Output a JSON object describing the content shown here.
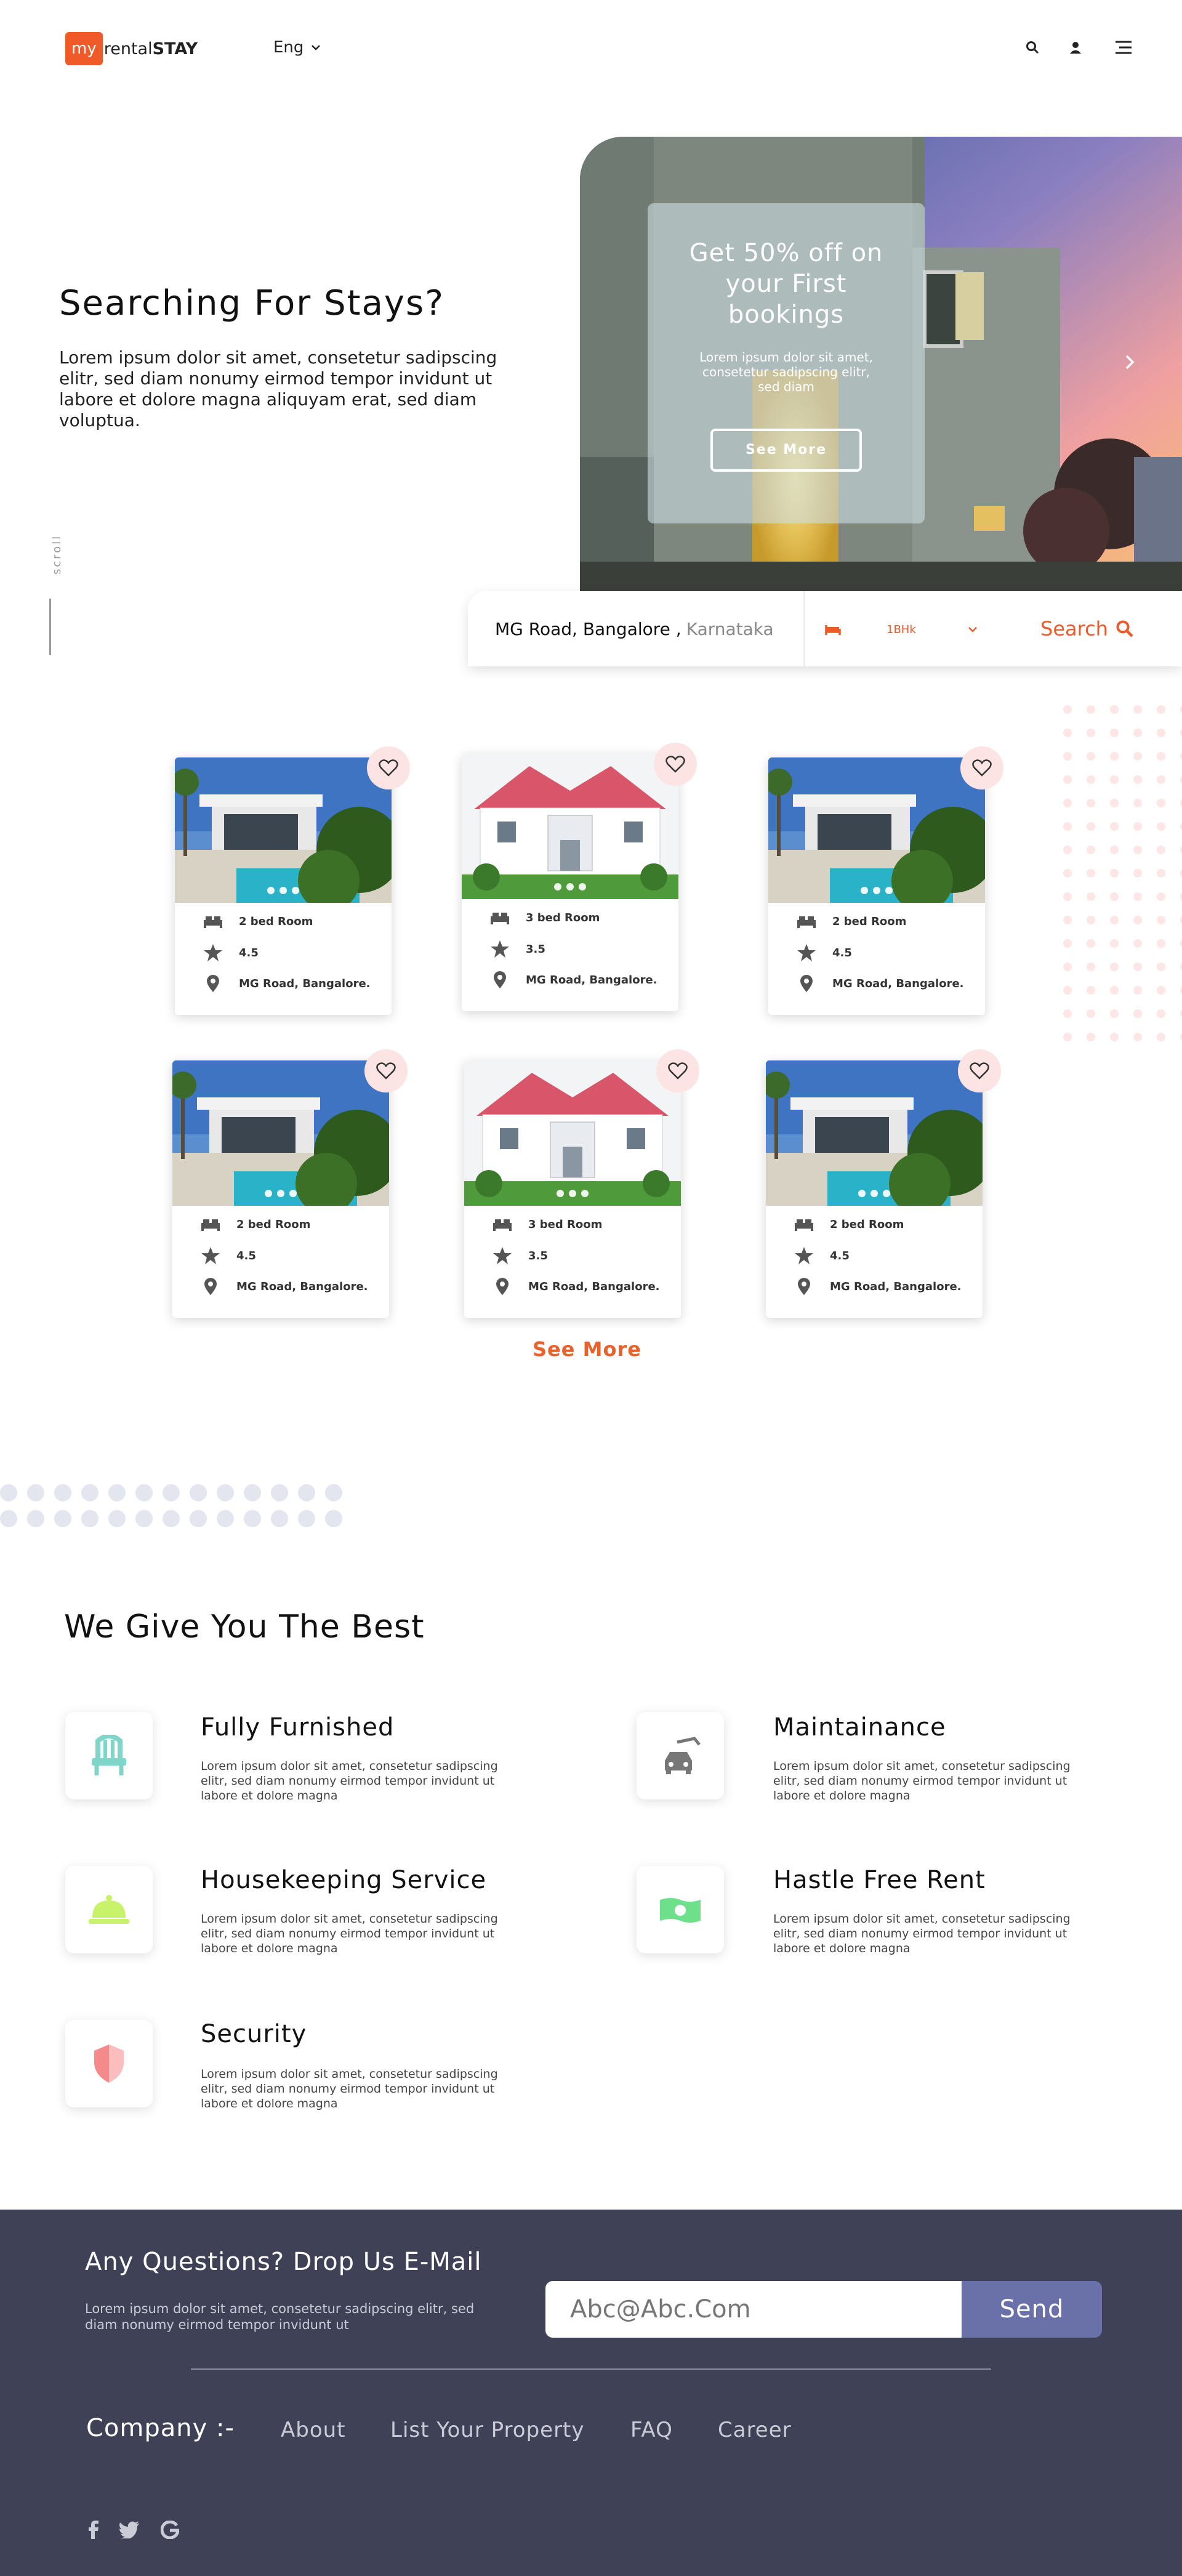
{
  "header": {
    "logo_my": "my",
    "logo_rental": "rental",
    "logo_stay": "STAY",
    "language": "Eng",
    "icons": [
      "search-icon",
      "user-icon",
      "menu-icon"
    ]
  },
  "hero": {
    "title": "Searching For Stays?",
    "text": "Lorem ipsum dolor sit amet, consetetur sadipscing elitr, sed diam nonumy eirmod tempor invidunt ut labore et dolore magna aliquyam erat, sed diam voluptua.",
    "scroll_label": "scroll",
    "promo": {
      "title": "Get 50% off on your First bookings",
      "text": "Lorem ipsum dolor sit amet, consetetur sadipscing elitr, sed diam",
      "button": "See More"
    }
  },
  "search": {
    "city": "MG Road, Bangalore ,",
    "state": "Karnataka",
    "room_type": "1BHk",
    "button": "Search"
  },
  "listings": [
    {
      "rooms": "2 bed Room",
      "rating": "4.5",
      "location": "MG Road, Bangalore.",
      "image": "modern-villa"
    },
    {
      "rooms": "3 bed Room",
      "rating": "3.5",
      "location": "MG Road, Bangalore.",
      "image": "white-house"
    },
    {
      "rooms": "2 bed Room",
      "rating": "4.5",
      "location": "MG Road, Bangalore.",
      "image": "modern-villa"
    },
    {
      "rooms": "2 bed Room",
      "rating": "4.5",
      "location": "MG Road, Bangalore.",
      "image": "modern-villa"
    },
    {
      "rooms": "3 bed Room",
      "rating": "3.5",
      "location": "MG Road, Bangalore.",
      "image": "white-house"
    },
    {
      "rooms": "2 bed Room",
      "rating": "4.5",
      "location": "MG Road, Bangalore.",
      "image": "modern-villa"
    }
  ],
  "see_more": "See More",
  "features": {
    "title": "We Give You The Best",
    "items": [
      {
        "title": "Fully Furnished",
        "text": "Lorem ipsum dolor sit amet, consetetur sadipscing elitr, sed diam nonumy eirmod tempor invidunt ut labore et dolore magna",
        "icon": "chair-icon",
        "color": "#7fd6c8"
      },
      {
        "title": "Maintainance",
        "text": "Lorem ipsum dolor sit amet, consetetur sadipscing elitr, sed diam nonumy eirmod tempor invidunt ut labore et dolore magna",
        "icon": "car-wash-icon",
        "color": "#777777"
      },
      {
        "title": "Housekeeping Service",
        "text": "Lorem ipsum dolor sit amet, consetetur sadipscing elitr, sed diam nonumy eirmod tempor invidunt ut labore et dolore magna",
        "icon": "service-bell-icon",
        "color": "#c8f26a"
      },
      {
        "title": "Hastle Free Rent",
        "text": "Lorem ipsum dolor sit amet, consetetur sadipscing elitr, sed diam nonumy eirmod tempor invidunt ut labore et dolore magna",
        "icon": "money-icon",
        "color": "#6ee08c"
      },
      {
        "title": "Security",
        "text": "Lorem ipsum dolor sit amet, consetetur sadipscing elitr, sed diam nonumy eirmod tempor invidunt ut labore et dolore magna",
        "icon": "shield-icon",
        "color": "#f58a8a"
      }
    ]
  },
  "footer": {
    "question_title": "Any Questions? Drop Us E-Mail",
    "question_text": "Lorem ipsum dolor sit amet, consetetur sadipscing elitr, sed diam nonumy eirmod tempor invidunt ut",
    "email_placeholder": "Abc@Abc.Com",
    "send": "Send",
    "company_label": "Company :-",
    "links": [
      "About",
      "List Your Property",
      "FAQ",
      "Career"
    ],
    "social": [
      "facebook-icon",
      "twitter-icon",
      "google-icon"
    ]
  },
  "colors": {
    "brand": "#f05a28",
    "accent": "#e8622e",
    "footer_bg": "#3f4257",
    "send_button": "#6a70a8"
  }
}
